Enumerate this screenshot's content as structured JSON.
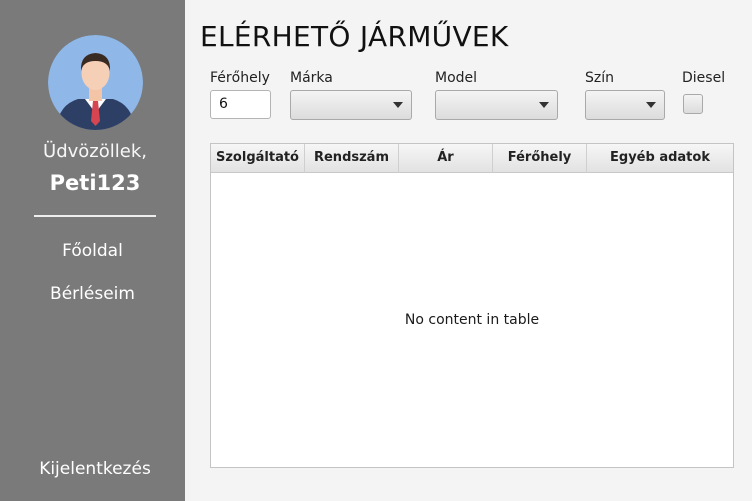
{
  "sidebar": {
    "welcome_text": "Üdvözöllek,",
    "username": "Peti123",
    "nav": {
      "home": "Főoldal",
      "rentals": "Bérléseim",
      "logout": "Kijelentkezés"
    },
    "avatar_icon": "user-avatar-icon"
  },
  "main": {
    "title": "ELÉRHETŐ JÁRMŰVEK",
    "filters": {
      "seats_label": "Férőhely",
      "seats_value": "6",
      "brand_label": "Márka",
      "brand_value": "",
      "model_label": "Model",
      "model_value": "",
      "color_label": "Szín",
      "color_value": "",
      "diesel_label": "Diesel",
      "diesel_checked": false
    },
    "table": {
      "columns": [
        "Szolgáltató",
        "Rendszám",
        "Ár",
        "Férőhely",
        "Egyéb adatok"
      ],
      "rows": [],
      "empty_message": "No content in table"
    }
  },
  "colors": {
    "sidebar_bg": "#7a7a7a",
    "main_bg": "#f4f4f4",
    "avatar_bg": "#8fb8e8"
  }
}
